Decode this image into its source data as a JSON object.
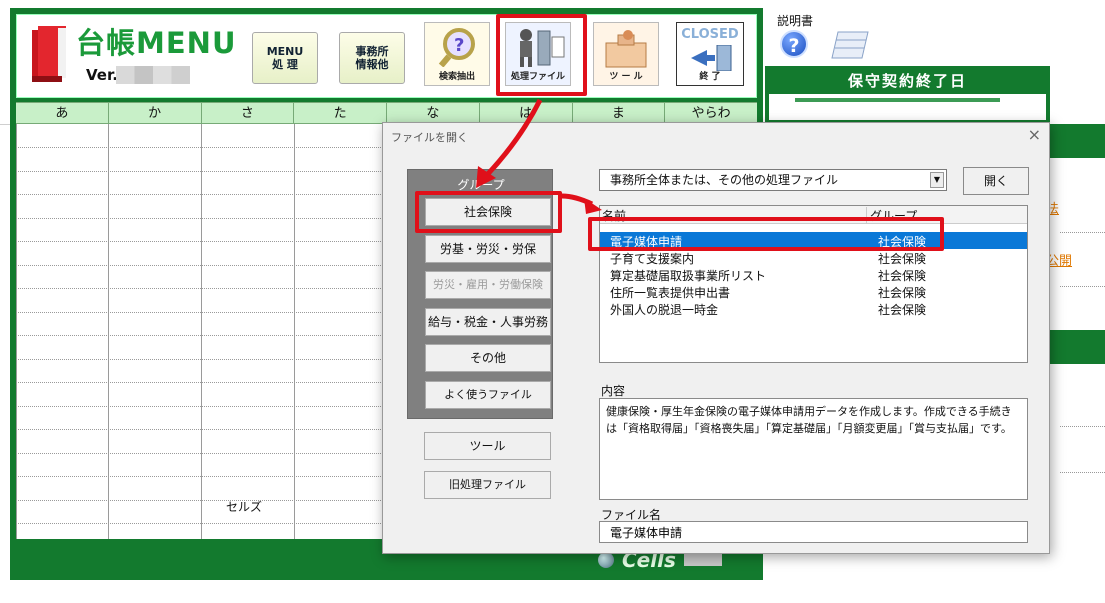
{
  "app": {
    "title": "台帳MENU",
    "version_prefix": "Ver.",
    "buttons": {
      "menu": "MENU\n処 理",
      "office": "事務所\n情報他",
      "search": "検索抽出",
      "files": "処理ファイル",
      "tools": "ツ ー ル",
      "closed": "CLOSED",
      "exit": "終 了"
    },
    "kana_tabs": [
      "あ",
      "か",
      "さ",
      "た",
      "な",
      "は",
      "ま",
      "やらわ"
    ],
    "grid_cell_text": "セルズ",
    "brand": "Cells"
  },
  "side": {
    "manual_label": "説明書",
    "maintenance_title": "保守契約終了日",
    "link_fragment_1": "法",
    "link_fragment_2": "公開"
  },
  "dialog": {
    "title": "ファイルを開く",
    "close_glyph": "×",
    "group_caption": "グループ",
    "groups": [
      "社会保険",
      "労基・労災・労保",
      "労災・雇用・労働保険",
      "給与・税金・人事労務",
      "その他",
      "よく使うファイル"
    ],
    "extra_buttons": [
      "ツール",
      "旧処理ファイル"
    ],
    "combo_value": "事務所全体または、その他の処理ファイル",
    "combo_arrow": "▼",
    "open_button": "開く",
    "list_columns": [
      "名前",
      "グループ"
    ],
    "list_rows": [
      {
        "name": "電子媒体申請",
        "group": "社会保険"
      },
      {
        "name": "子育て支援案内",
        "group": "社会保険"
      },
      {
        "name": "算定基礎届取扱事業所リスト",
        "group": "社会保険"
      },
      {
        "name": "住所一覧表提供申出書",
        "group": "社会保険"
      },
      {
        "name": "外国人の脱退一時金",
        "group": "社会保険"
      }
    ],
    "content_label": "内容",
    "content_text": "健康保険・厚生年金保険の電子媒体申請用データを作成します。作成できる手続きは「資格取得届」「資格喪失届」「算定基礎届」「月額変更届」「賞与支払届」です。",
    "filename_label": "ファイル名",
    "filename_value": "電子媒体申請"
  },
  "colors": {
    "main_green": "#137a2e",
    "title_green": "#1b9a3a",
    "highlight_red": "#e0101a",
    "selection_blue": "#0a78d7"
  }
}
